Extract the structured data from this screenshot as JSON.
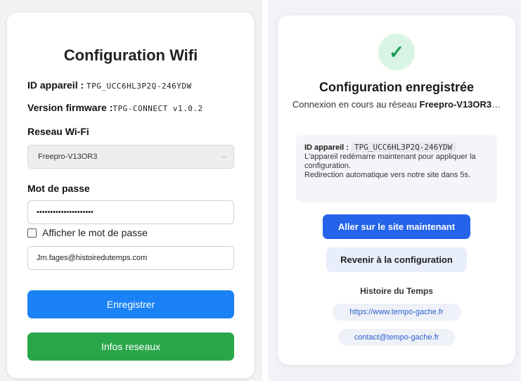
{
  "wifi_config": {
    "title": "Configuration Wifi",
    "device_id_label": "ID appareil : ",
    "device_id_value": "TPG_UCC6HL3P2Q-246YDW",
    "firmware_label": "Version firmware :",
    "firmware_value": "TPG-CONNECT v1.0.2",
    "wifi_label": "Reseau Wi-Fi",
    "wifi_selected": "Freepro-V13OR3",
    "password_label": "Mot de passe",
    "password_value": "•••••••••••••••••••••",
    "show_password_label": "Afficher le mot de passe",
    "email_value": "Jm.fages@histoiredutemps.com",
    "save_button": "Enregistrer",
    "network_info_button": "Infos reseaux"
  },
  "confirmation": {
    "check_glyph": "✓",
    "title": "Configuration enregistrée",
    "subtitle_prefix": "Connexion en cours au réseau ",
    "network_name": "Freepro-V13OR3",
    "subtitle_suffix": "…",
    "device_id_label": "ID appareil :",
    "device_id_value": "TPG_UCC6HL3P2Q-246YDW",
    "restart_message": "L'appareil redémarre maintenant pour appliquer la configuration.",
    "redirect_message": "Redirection automatique vers notre site dans 5s.",
    "go_site_button": "Aller sur le site maintenant",
    "back_config_button": "Revenir à la configuration",
    "company_name": "Histoire du Temps",
    "website_link": "https://www.tempo-gache.fr",
    "contact_link": "contact@tempo-gache.fr"
  },
  "colors": {
    "primary_blue": "#1a82f5",
    "success_green": "#2aa64a",
    "confirm_blue": "#2563eb"
  },
  "icons": {
    "select_chevron": "chevron-down-icon",
    "success": "check-icon"
  }
}
